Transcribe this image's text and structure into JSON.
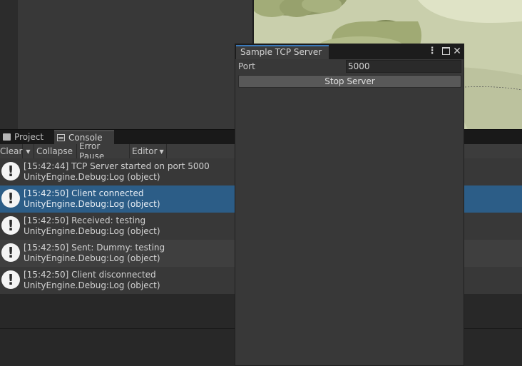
{
  "console": {
    "tabs": [
      {
        "label": "Project",
        "icon": "folder-icon"
      },
      {
        "label": "Console",
        "icon": "console-icon",
        "active": true
      }
    ],
    "toolbar": {
      "clear_label": "Clear",
      "collapse_label": "Collapse",
      "error_pause_label": "Error Pause",
      "editor_label": "Editor"
    },
    "logs": [
      {
        "message": "[15:42:44] TCP Server started on port 5000",
        "source": "UnityEngine.Debug:Log (object)",
        "icon": "info-icon"
      },
      {
        "message": "[15:42:50] Client connected",
        "source": "UnityEngine.Debug:Log (object)",
        "icon": "info-icon",
        "selected": true
      },
      {
        "message": "[15:42:50] Received: testing",
        "source": "UnityEngine.Debug:Log (object)",
        "icon": "info-icon"
      },
      {
        "message": "[15:42:50] Sent: Dummy: testing",
        "source": "UnityEngine.Debug:Log (object)",
        "icon": "info-icon"
      },
      {
        "message": "[15:42:50] Client disconnected",
        "source": "UnityEngine.Debug:Log (object)",
        "icon": "info-icon"
      }
    ]
  },
  "tcp_window": {
    "title": "Sample TCP Server",
    "port_label": "Port",
    "port_value": "5000",
    "stop_button_label": "Stop Server",
    "accent_color": "#3a79bb"
  },
  "colors": {
    "selected_row": "#2c5d87",
    "scene_ground": "#c9cfac"
  }
}
